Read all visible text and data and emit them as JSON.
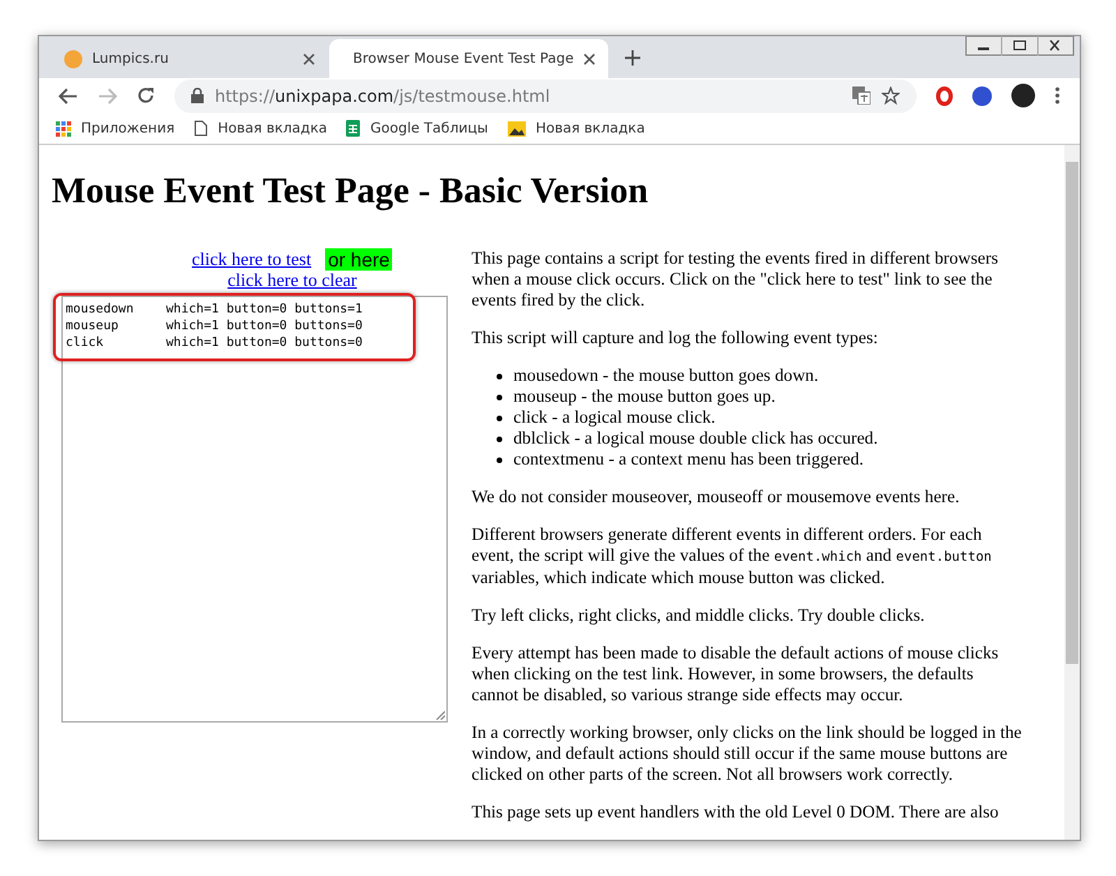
{
  "window": {
    "tabs": [
      {
        "title": "Lumpics.ru",
        "selected": false
      },
      {
        "title": "Browser Mouse Event Test Page",
        "selected": true
      }
    ],
    "address": {
      "scheme": "https://",
      "host": "unixpapa.com",
      "path": "/js/testmouse.html"
    },
    "bookmarks": [
      {
        "kind": "apps",
        "label": "Приложения"
      },
      {
        "kind": "page",
        "label": "Новая вкладка"
      },
      {
        "kind": "sheets",
        "label": "Google Таблицы"
      },
      {
        "kind": "image",
        "label": "Новая вкладка"
      }
    ]
  },
  "page": {
    "heading": "Mouse Event Test Page - Basic Version",
    "test_link": "click here to test",
    "or_here": "or here",
    "clear_link": "click here to clear",
    "log": [
      [
        "mousedown",
        "which=1 button=0 buttons=1"
      ],
      [
        "mouseup",
        "which=1 button=0 buttons=0"
      ],
      [
        "click",
        "which=1 button=0 buttons=0"
      ]
    ],
    "intro": "This page contains a script for testing the events fired in different browsers when a mouse click occurs. Click on the \"click here to test\" link to see the events fired by the click.",
    "list_intro": "This script will capture and log the following event types:",
    "event_types": [
      "mousedown - the mouse button goes down.",
      "mouseup - the mouse button goes up.",
      "click - a logical mouse click.",
      "dblclick - a logical mouse double click has occured.",
      "contextmenu - a context menu has been triggered."
    ],
    "paragraphs": [
      [
        {
          "kind": "text",
          "text": "We do not consider mouseover, mouseoff or mousemove events here."
        }
      ],
      [
        {
          "kind": "text",
          "text": "Different browsers generate different events in different orders. For each event, the script will give the values of the "
        },
        {
          "kind": "code",
          "text": "event.which"
        },
        {
          "kind": "text",
          "text": " and "
        },
        {
          "kind": "code",
          "text": "event.button"
        },
        {
          "kind": "text",
          "text": " variables, which indicate which mouse button was clicked."
        }
      ],
      [
        {
          "kind": "text",
          "text": "Try left clicks, right clicks, and middle clicks. Try double clicks."
        }
      ],
      [
        {
          "kind": "text",
          "text": "Every attempt has been made to disable the default actions of mouse clicks when clicking on the test link. However, in some browsers, the defaults cannot be disabled, so various strange side effects may occur."
        }
      ],
      [
        {
          "kind": "text",
          "text": "In a correctly working browser, only clicks on the link should be logged in the window, and default actions should still occur if the same mouse buttons are clicked on other parts of the screen. Not all browsers work correctly."
        }
      ],
      [
        {
          "kind": "text",
          "text": "This page sets up event handlers with the old Level 0 DOM. There are also"
        }
      ]
    ]
  }
}
